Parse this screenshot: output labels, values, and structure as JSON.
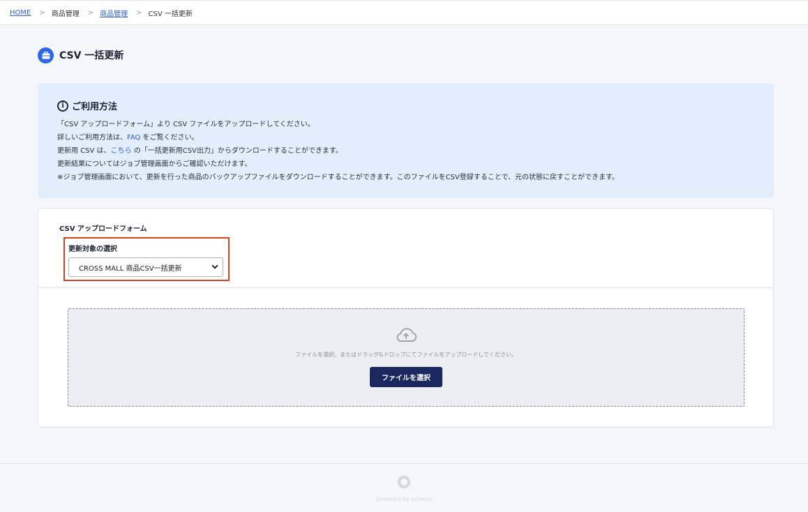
{
  "breadcrumb": {
    "home": "HOME",
    "separator": ">",
    "products": "商品管理",
    "products_link": "商品管理",
    "current": "CSV 一括更新"
  },
  "page": {
    "title": "CSV 一括更新",
    "icon": "briefcase-icon"
  },
  "info": {
    "title": "ご利用方法",
    "line1": "「CSV アップロードフォーム」より CSV ファイルをアップロードしてください。",
    "line2_pre": "詳しいご利用方法は、",
    "line2_link": "FAQ",
    "line2_post": " をご覧ください。",
    "line3_pre": "更新用 CSV は、",
    "line3_link": "こちら",
    "line3_post": " の「一括更新用CSV出力」からダウンロードすることができます。",
    "line4": "更新結果についてはジョブ管理画面からご確認いただけます。",
    "line5": "※ジョブ管理画面において、更新を行った商品のバックアップファイルをダウンロードすることができます。このファイルをCSV登録することで、元の状態に戻すことができます。"
  },
  "form": {
    "title": "CSV アップロードフォーム",
    "select_label": "更新対象の選択",
    "select_value": "CROSS MALL 商品CSV一括更新"
  },
  "dropzone": {
    "text": "ファイルを選択、またはドラッグ&ドロップにてファイルをアップロードしてください。",
    "button": "ファイルを選択"
  },
  "footer": {
    "text": "powered by ecforce"
  },
  "colors": {
    "accent": "#2f66e6",
    "info_bg": "#e2eefb",
    "highlight": "#d3431f",
    "button": "#1b2860"
  }
}
